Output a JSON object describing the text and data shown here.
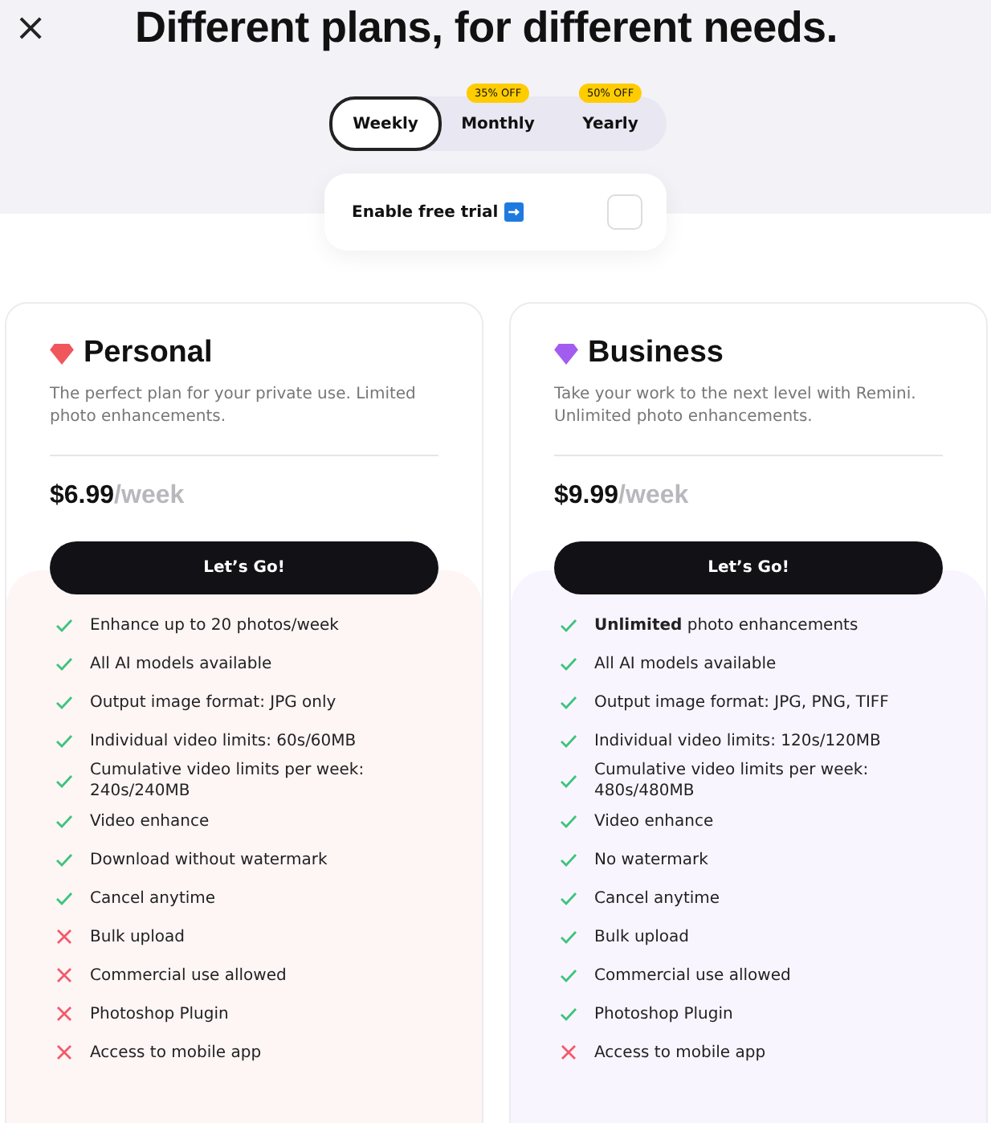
{
  "close": "×",
  "title": "Different plans, for different needs.",
  "periods": [
    {
      "label": "Weekly",
      "selected": true
    },
    {
      "label": "Monthly",
      "badge": "35% OFF",
      "selected": false
    },
    {
      "label": "Yearly",
      "badge": "50% OFF",
      "selected": false
    }
  ],
  "trial": {
    "label": "Enable free trial",
    "checked": false
  },
  "plans": [
    {
      "name": "Personal",
      "color": "#f0575d",
      "description": "The perfect plan for your private use. Limited photo enhancements.",
      "price": "$6.99",
      "period": "/week",
      "button": "Let’s Go!",
      "features": [
        {
          "text": "Enhance up to 20 photos/week",
          "included": true
        },
        {
          "text": "All AI models available",
          "included": true
        },
        {
          "text": "Output image format: JPG only",
          "included": true
        },
        {
          "text": "Individual video limits: 60s/60MB",
          "included": true
        },
        {
          "text": "Cumulative video limits per week: 240s/240MB",
          "included": true
        },
        {
          "text": "Video enhance",
          "included": true
        },
        {
          "text": "Download without watermark",
          "included": true
        },
        {
          "text": "Cancel anytime",
          "included": true
        },
        {
          "text": "Bulk upload",
          "included": false
        },
        {
          "text": "Commercial use allowed",
          "included": false
        },
        {
          "text": "Photoshop Plugin",
          "included": false
        },
        {
          "text": "Access to mobile app",
          "included": false
        }
      ]
    },
    {
      "name": "Business",
      "color": "#a35cf0",
      "description": "Take your work to the next level with Remini. Unlimited photo enhancements.",
      "price": "$9.99",
      "period": "/week",
      "button": "Let’s Go!",
      "features": [
        {
          "text": "**Unlimited** photo enhancements",
          "included": true
        },
        {
          "text": "All AI models available",
          "included": true
        },
        {
          "text": "Output image format: JPG, PNG, TIFF",
          "included": true
        },
        {
          "text": "Individual video limits: 120s/120MB",
          "included": true
        },
        {
          "text": "Cumulative video limits per week: 480s/480MB",
          "included": true
        },
        {
          "text": "Video enhance",
          "included": true
        },
        {
          "text": "No watermark",
          "included": true
        },
        {
          "text": "Cancel anytime",
          "included": true
        },
        {
          "text": "Bulk upload",
          "included": true
        },
        {
          "text": "Commercial use allowed",
          "included": true
        },
        {
          "text": "Photoshop Plugin",
          "included": true
        },
        {
          "text": "Access to mobile app",
          "included": false
        }
      ]
    }
  ]
}
